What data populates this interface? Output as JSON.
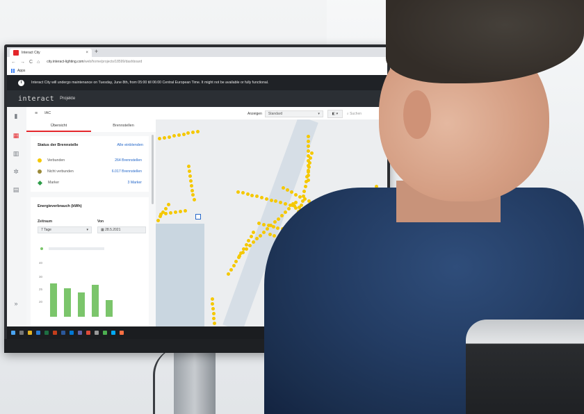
{
  "browser": {
    "tab_title": "Interact City",
    "tab_close": "×",
    "new_tab": "+",
    "nav_back": "←",
    "nav_forward": "→",
    "nav_reload": "C",
    "nav_home": "⌂",
    "url_host": "city.interact-lighting.com",
    "url_path": "/web/home/projects/18599/dashboard",
    "bookmarks_label": "Apps"
  },
  "notice": {
    "text": "Interact City will undergo maintenance on Tuesday, June 8th, from 05:00 till 06:00 Central European Time. It might not be available or fully functional."
  },
  "app": {
    "brand": "interact",
    "nav_projects": "Projekte"
  },
  "filterbar": {
    "project": "IAC",
    "show_label": "Anzeigen",
    "view_value": "Standard",
    "search_placeholder": "Suchen"
  },
  "panel": {
    "tabs": [
      {
        "label": "Übersicht",
        "active": true
      },
      {
        "label": "Brennstellen",
        "active": false
      }
    ],
    "status": {
      "title": "Status der Brennstelle",
      "show_all": "Alle einblenden",
      "rows": [
        {
          "label": "Verbunden",
          "value": "264 Brennstellen",
          "color": "#f5c800"
        },
        {
          "label": "Nicht verbunden",
          "value": "6.017 Brennstellen",
          "color": "#9b8a3a"
        },
        {
          "label": "Marker",
          "value": "3 Marker",
          "color": "#2f9d4a"
        }
      ]
    },
    "energy": {
      "title": "Energieverbrauch (kWh)",
      "period_label": "Zeitraum",
      "period_value": "7 Tage",
      "from_label": "Von",
      "from_value": "28.5.2021",
      "y_ticks": [
        "40",
        "30",
        "25",
        "20"
      ],
      "bar_levels": [
        0.8,
        0.68,
        0.58,
        0.76,
        0.4
      ]
    }
  },
  "colors": {
    "accent": "#e4262b",
    "link": "#2467c9",
    "connected": "#f5c800"
  }
}
